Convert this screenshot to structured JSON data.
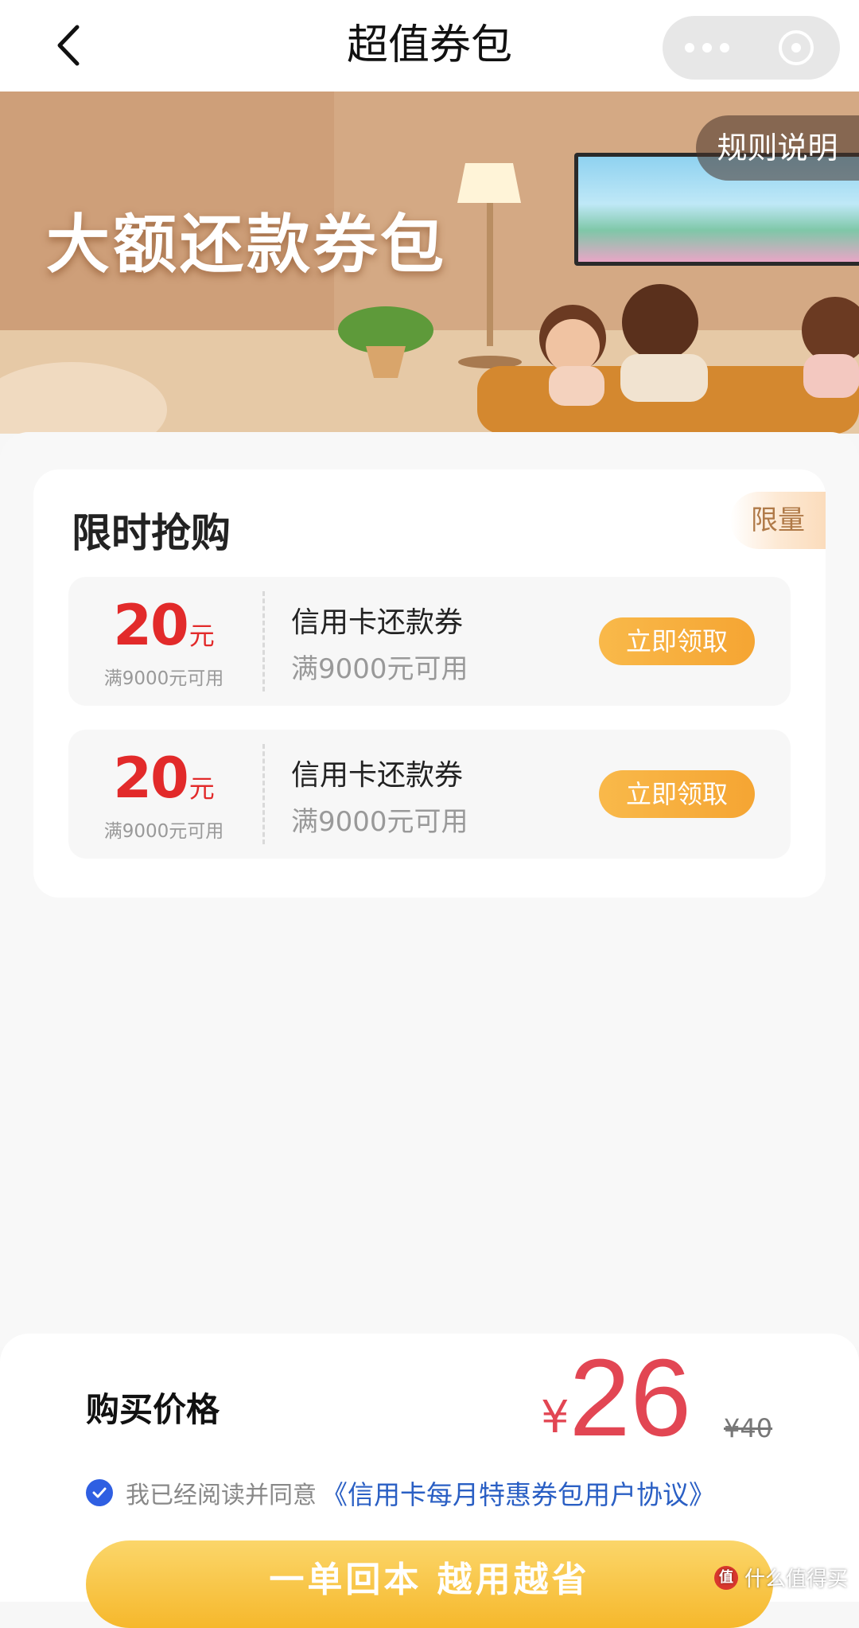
{
  "nav": {
    "title": "超值券包",
    "back_icon": "chevron-left-icon",
    "more_icon": "more-dots-icon",
    "close_icon": "close-circle-icon"
  },
  "banner": {
    "headline": "大额还款券包",
    "rules_label": "规则说明"
  },
  "section": {
    "title": "限时抢购",
    "tag": "限量"
  },
  "coupons": [
    {
      "amount": "20",
      "unit": "元",
      "condition_small": "满9000元可用",
      "name": "信用卡还款券",
      "condition": "满9000元可用",
      "button": "立即领取"
    },
    {
      "amount": "20",
      "unit": "元",
      "condition_small": "满9000元可用",
      "name": "信用卡还款券",
      "condition": "满9000元可用",
      "button": "立即领取"
    }
  ],
  "purchase": {
    "label": "购买价格",
    "currency": "¥",
    "price": "26",
    "original_price": "¥40",
    "agree_text": "我已经阅读并同意",
    "agreement_link": "《信用卡每月特惠券包用户协议》",
    "cta": "一单回本 越用越省"
  },
  "watermark": {
    "logo": "值",
    "text": "什么值得买"
  },
  "colors": {
    "accent_red": "#e22a2a",
    "button_orange": "#f5a533",
    "link_blue": "#2a5fc4",
    "cta_yellow": "#f6b82c"
  }
}
